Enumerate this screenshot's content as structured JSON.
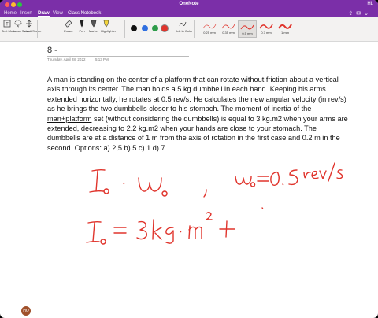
{
  "window": {
    "title": "OneNote",
    "right_label": "HL"
  },
  "ribbon": {
    "tabs": [
      "Home",
      "Insert",
      "Draw",
      "View",
      "Class Notebook"
    ],
    "tools": [
      {
        "label": "Text Mode"
      },
      {
        "label": "Lasso Select"
      },
      {
        "label": "Insert Space"
      },
      {
        "label": "Eraser"
      },
      {
        "label": "Pen"
      },
      {
        "label": "Marker"
      },
      {
        "label": "Highlighter"
      }
    ],
    "colors": [
      "#111111",
      "#2f6fe0",
      "#2e9c4a",
      "#e0342c"
    ],
    "ink_to_color_label": "Ink to Color",
    "pen_sizes": [
      "0.25 mm",
      "0.35 mm",
      "0.5 mm",
      "0.7 mm",
      "1 mm"
    ],
    "selected_pen_size": "0.5 mm",
    "ink_color": "#e0342c"
  },
  "page": {
    "title": "8 -",
    "date": "Thursday, April 28, 2022",
    "time": "5:13 PM",
    "problem_part1": "A man is standing on the center of a platform that can rotate without friction about a vertical axis through its center. The man holds a 5 kg dumbbell in each hand. Keeping his arms extended horizontally, he rotates at 0.5 rev/s. He calculates the new angular velocity (in rev/s) as he brings the two dumbbells closer to his stomach. The moment of inertia of the ",
    "problem_underlined": "man+platform",
    "problem_part2": " set (without considering the dumbbells) is equal to 3 kg.m2 when your arms are extended, decreasing to 2.2 kg.m2 when your hands are close to your stomach. The dumbbells are at a distance of 1 m from the axis of rotation in the first case and 0.2 m in the second. Options: a) 2,5 b) 5 c) 1 d) 7",
    "handwriting": [
      "I₀ · ω₀ ,",
      "ω₀ = 0.5 rev/s",
      "I₀ = 3 kg · m² +"
    ]
  },
  "user": {
    "initials": "HO"
  }
}
